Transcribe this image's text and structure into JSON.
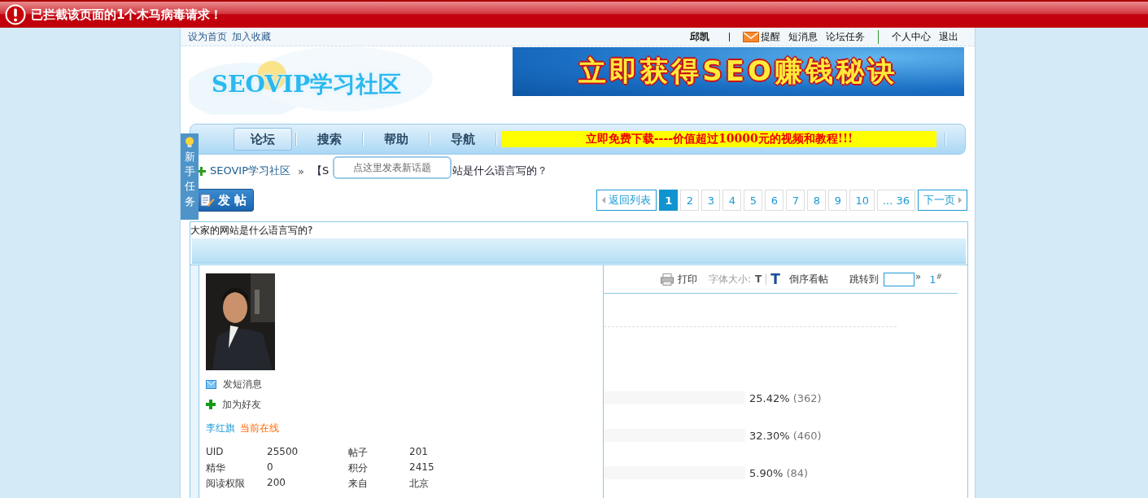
{
  "alert": {
    "text": "已拦截该页面的1个木马病毒请求！"
  },
  "top_links": {
    "left": [
      "设为首页",
      "加入收藏"
    ],
    "user": "邱凯",
    "right": [
      {
        "label": "提醒",
        "kind": "mail"
      },
      {
        "label": "短消息",
        "kind": "plain"
      },
      {
        "label": "论坛任务",
        "kind": "plain"
      },
      {
        "label": "个人中心",
        "kind": "plain",
        "divider": true
      },
      {
        "label": "退出",
        "kind": "plain"
      }
    ]
  },
  "logo": {
    "text": "SEOVIP学习社区"
  },
  "banner": {
    "text": "立即获得SEO赚钱秘诀"
  },
  "nav": {
    "items": [
      {
        "label": "论坛",
        "selected": true
      },
      {
        "label": "搜索",
        "selected": false
      },
      {
        "label": "帮助",
        "selected": false
      },
      {
        "label": "导航",
        "selected": false
      }
    ],
    "promo": "立即免费下载----价值超过10000元的视频和教程!!!"
  },
  "side_tab": {
    "label": "新手任务"
  },
  "breadcrumb": {
    "home": "SEOVIP学习社区",
    "sep": "»",
    "before": "【S",
    "after": "站是什么语言写的？"
  },
  "tooltip": "点这里发表新话题",
  "post_button": "发 帖",
  "pagination": {
    "back": "返回列表",
    "pages": [
      {
        "label": "1",
        "selected": true
      },
      {
        "label": "2",
        "selected": false
      },
      {
        "label": "3",
        "selected": false
      },
      {
        "label": "4",
        "selected": false
      },
      {
        "label": "5",
        "selected": false
      },
      {
        "label": "6",
        "selected": false
      },
      {
        "label": "7",
        "selected": false
      },
      {
        "label": "8",
        "selected": false
      },
      {
        "label": "9",
        "selected": false
      },
      {
        "label": "10",
        "selected": false
      },
      {
        "label": "... 36",
        "selected": false
      }
    ],
    "next": "下一页"
  },
  "thread": {
    "title": "大家的网站是什么语言写的?"
  },
  "author": {
    "actions": [
      {
        "label": "发短消息",
        "kind": "message"
      },
      {
        "label": "加为好友",
        "kind": "add"
      }
    ],
    "name": "李红旗",
    "status": "当前在线",
    "stats": [
      [
        "UID",
        "25500",
        "帖子",
        "201"
      ],
      [
        "精华",
        "0",
        "积分",
        "2415"
      ],
      [
        "阅读权限",
        "200",
        "来自",
        "北京"
      ]
    ]
  },
  "toolbar": {
    "print": "打印",
    "font_label": "字体大小:",
    "font_small": "T",
    "font_large": "T",
    "reverse": "倒序看帖",
    "jump": "跳转到",
    "jump_arrow": "»",
    "floor": "1",
    "floor_mark": "#"
  },
  "poll": [
    {
      "result": "25.42%",
      "count": "(362)"
    },
    {
      "result": "32.30%",
      "count": "(460)"
    },
    {
      "result": "5.90%",
      "count": "(84)"
    }
  ]
}
